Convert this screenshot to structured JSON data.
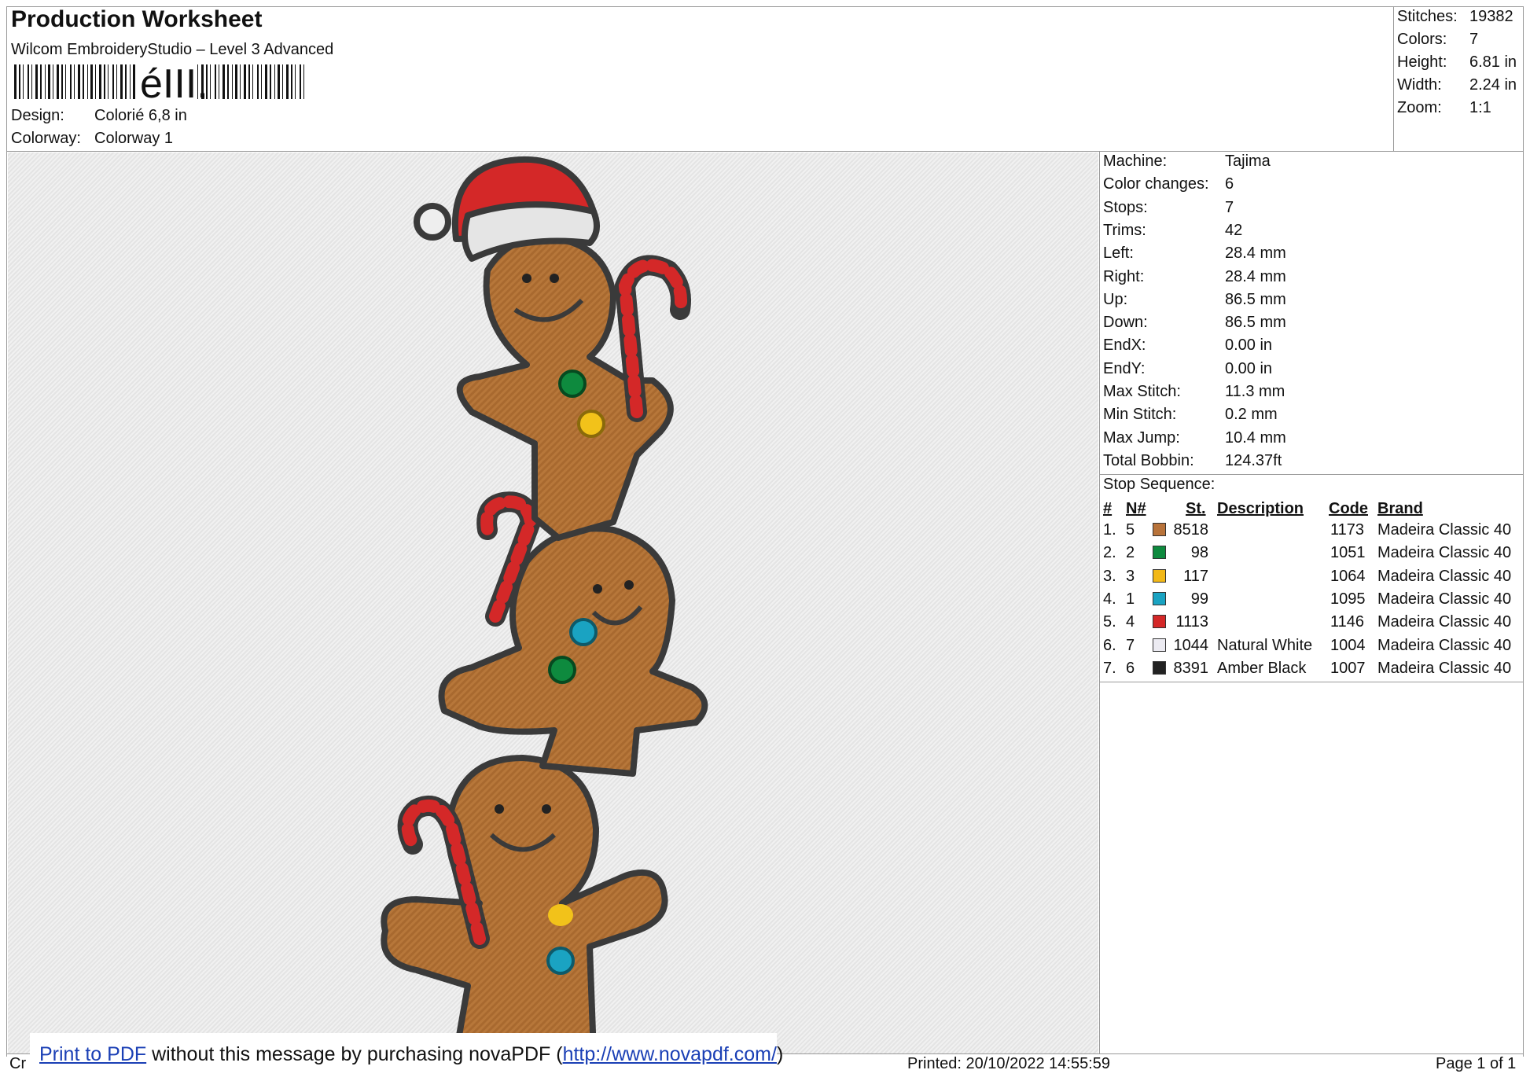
{
  "header": {
    "title": "Production Worksheet",
    "software": "Wilcom EmbroideryStudio – Level 3 Advanced",
    "barcode_text": "éIII,",
    "design_label": "Design:",
    "design_value": "Colorié 6,8 in",
    "colorway_label": "Colorway:",
    "colorway_value": "Colorway 1"
  },
  "summary": [
    {
      "label": "Stitches:",
      "value": "19382"
    },
    {
      "label": "Colors:",
      "value": "7"
    },
    {
      "label": "Height:",
      "value": "6.81 in"
    },
    {
      "label": "Width:",
      "value": "2.24 in"
    },
    {
      "label": "Zoom:",
      "value": "1:1"
    }
  ],
  "machine": [
    {
      "label": "Machine:",
      "value": "Tajima"
    },
    {
      "label": "Color changes:",
      "value": "6"
    },
    {
      "label": "Stops:",
      "value": "7"
    },
    {
      "label": "Trims:",
      "value": "42"
    },
    {
      "label": "Left:",
      "value": "28.4 mm"
    },
    {
      "label": "Right:",
      "value": "28.4 mm"
    },
    {
      "label": "Up:",
      "value": "86.5 mm"
    },
    {
      "label": "Down:",
      "value": "86.5 mm"
    },
    {
      "label": "EndX:",
      "value": "0.00 in"
    },
    {
      "label": "EndY:",
      "value": "0.00 in"
    },
    {
      "label": "Max Stitch:",
      "value": "11.3 mm"
    },
    {
      "label": "Min Stitch:",
      "value": "0.2 mm"
    },
    {
      "label": "Max Jump:",
      "value": "10.4 mm"
    },
    {
      "label": "Total Bobbin:",
      "value": "124.37ft"
    }
  ],
  "stop_sequence": {
    "title": "Stop Sequence:",
    "headers": {
      "num": "#",
      "needle": "N#",
      "stitches": "St.",
      "description": "Description",
      "code": "Code",
      "brand": "Brand"
    },
    "rows": [
      {
        "num": "1.",
        "needle": "5",
        "color": "#b8733a",
        "stitches": "8518",
        "description": "",
        "code": "1173",
        "brand": "Madeira Classic 40"
      },
      {
        "num": "2.",
        "needle": "2",
        "color": "#0e8a3e",
        "stitches": "98",
        "description": "",
        "code": "1051",
        "brand": "Madeira Classic 40"
      },
      {
        "num": "3.",
        "needle": "3",
        "color": "#f2b817",
        "stitches": "117",
        "description": "",
        "code": "1064",
        "brand": "Madeira Classic 40"
      },
      {
        "num": "4.",
        "needle": "1",
        "color": "#1aa3c2",
        "stitches": "99",
        "description": "",
        "code": "1095",
        "brand": "Madeira Classic 40"
      },
      {
        "num": "5.",
        "needle": "4",
        "color": "#d42828",
        "stitches": "1113",
        "description": "",
        "code": "1146",
        "brand": "Madeira Classic 40"
      },
      {
        "num": "6.",
        "needle": "7",
        "color": "#ecebf2",
        "stitches": "1044",
        "description": "Natural White",
        "code": "1004",
        "brand": "Madeira Classic 40"
      },
      {
        "num": "7.",
        "needle": "6",
        "color": "#222222",
        "stitches": "8391",
        "description": "Amber Black",
        "code": "1007",
        "brand": "Madeira Classic 40"
      }
    ]
  },
  "footer": {
    "left_text": "Cr",
    "nova_link": "Print to PDF",
    "nova_text": " without this message by purchasing novaPDF (",
    "nova_url": "http://www.novapdf.com/",
    "nova_close": ")",
    "printed": "Printed: 20/10/2022 14:55:59",
    "page": "Page 1 of 1"
  }
}
